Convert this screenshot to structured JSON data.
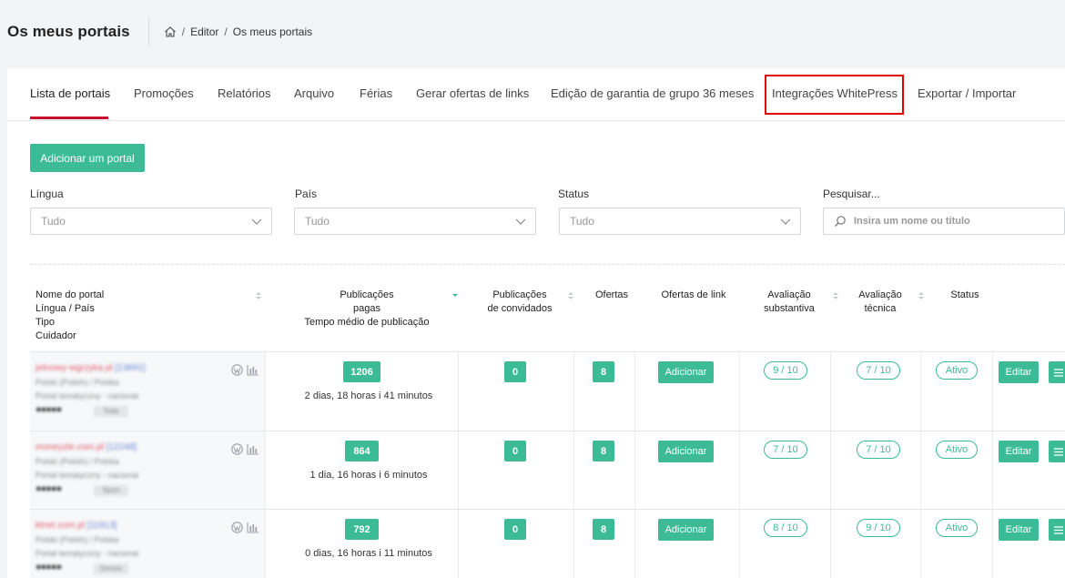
{
  "header": {
    "title": "Os meus portais",
    "breadcrumb": [
      "Editor",
      "Os meus portais"
    ],
    "breadcrumb_sep": "/"
  },
  "tabs": [
    {
      "label": "Lista de portais",
      "active": true
    },
    {
      "label": "Promoções"
    },
    {
      "label": "Relatórios"
    },
    {
      "label": "Arquivo"
    },
    {
      "label": "Férias"
    },
    {
      "label": "Gerar ofertas de links"
    },
    {
      "label": "Edição de garantia de grupo 36 meses"
    },
    {
      "label": "Integrações WhitePress",
      "highlighted": true
    },
    {
      "label": "Exportar / Importar"
    }
  ],
  "add_button": "Adicionar um portal",
  "filters": {
    "language": {
      "label": "Língua",
      "value": "Tudo"
    },
    "country": {
      "label": "País",
      "value": "Tudo"
    },
    "status": {
      "label": "Status",
      "value": "Tudo"
    },
    "search": {
      "label": "Pesquisar...",
      "placeholder": "Insira um nome ou título"
    }
  },
  "table": {
    "headers": {
      "portal": [
        "Nome do portal",
        "Língua / País",
        "Tipo",
        "Cuidador"
      ],
      "paid": [
        "Publicações",
        "pagas",
        "Tempo médio de publicação"
      ],
      "guest": [
        "Publicações",
        "de convidados"
      ],
      "offers": "Ofertas",
      "link_offers": "Ofertas de link",
      "substantive": [
        "Avaliação",
        "substantiva"
      ],
      "technical": [
        "Avaliação",
        "técnica"
      ],
      "status": "Status"
    },
    "rows": [
      {
        "blur_name": "jetnowy-wgrzyka.pl",
        "blur_id": "[13891]",
        "blur_lang": "Polski (Polish) / Polska",
        "blur_lang_b": "(Polska)",
        "blur_type": "Portal tematyczny - nacional",
        "blur_chip": "Tode",
        "paid": "1206",
        "avg_time": "2 dias, 18 horas i 41 minutos",
        "guest": "0",
        "offers": "8",
        "link_btn": "Adicionar",
        "substantive": "9 / 10",
        "technical": "7 / 10",
        "status": "Ativo",
        "edit": "Editar"
      },
      {
        "blur_name": "moneyzle.com.pl",
        "blur_id": "[12248]",
        "blur_lang": "Polski (Polish) / Polska",
        "blur_lang_b": "(Polska)",
        "blur_type": "Portal tematyczny - nacional",
        "blur_chip": "Sport",
        "paid": "864",
        "avg_time": "1 dia, 16 horas i 6 minutos",
        "guest": "0",
        "offers": "8",
        "link_btn": "Adicionar",
        "substantive": "7 / 10",
        "technical": "7 / 10",
        "status": "Ativo",
        "edit": "Editar"
      },
      {
        "blur_name": "ktnet.com.pl",
        "blur_id": "[11913]",
        "blur_lang": "Polski (Polish) / Polska",
        "blur_lang_b": "(Polska)",
        "blur_type": "Portal tematyczny - nacional",
        "blur_chip": "Serwis",
        "paid": "792",
        "avg_time": "0 dias, 16 horas i 11 minutos",
        "guest": "0",
        "offers": "8",
        "link_btn": "Adicionar",
        "substantive": "8 / 10",
        "technical": "9 / 10",
        "status": "Ativo",
        "edit": "Editar"
      }
    ]
  },
  "colors": {
    "accent": "#3dbb96",
    "active_tab": "#c8102e",
    "highlight": "#e00000"
  },
  "icons": [
    "home-icon",
    "chevron-down-icon",
    "search-icon",
    "wordpress-icon",
    "bar-chart-icon",
    "sort-icon",
    "hamburger-menu-icon"
  ]
}
